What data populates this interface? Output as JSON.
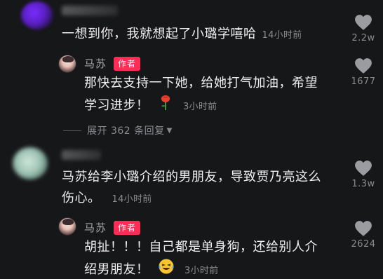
{
  "comments": [
    {
      "text": "一想到你，我就想起了小璐学嘻哈",
      "time": "14小时前",
      "likes": "2.2w",
      "reply": {
        "author": "马苏",
        "badge": "作者",
        "text_line1": "那快去支持一下她，给她打气加油，希望",
        "text_line2": "学习进步！",
        "emoji": "rose-icon",
        "time": "3小时前",
        "likes": "1677"
      },
      "expand_label": "展开 362 条回复"
    },
    {
      "text_line1": "马苏给李小璐介绍的男朋友，导致贾乃亮这么",
      "text_line2": "伤心。",
      "time": "14小时前",
      "likes": "1.3w",
      "reply": {
        "author": "马苏",
        "badge": "作者",
        "text_line1": "胡扯！！！自己都是单身狗，还给别人介",
        "text_line2": "绍男朋友！",
        "emoji": "laughing-tears-icon",
        "time": "3小时前",
        "likes": "2624"
      }
    }
  ],
  "colors": {
    "background": "#161719",
    "badge": "#ff2c55",
    "muted": "#8a8b8f"
  }
}
